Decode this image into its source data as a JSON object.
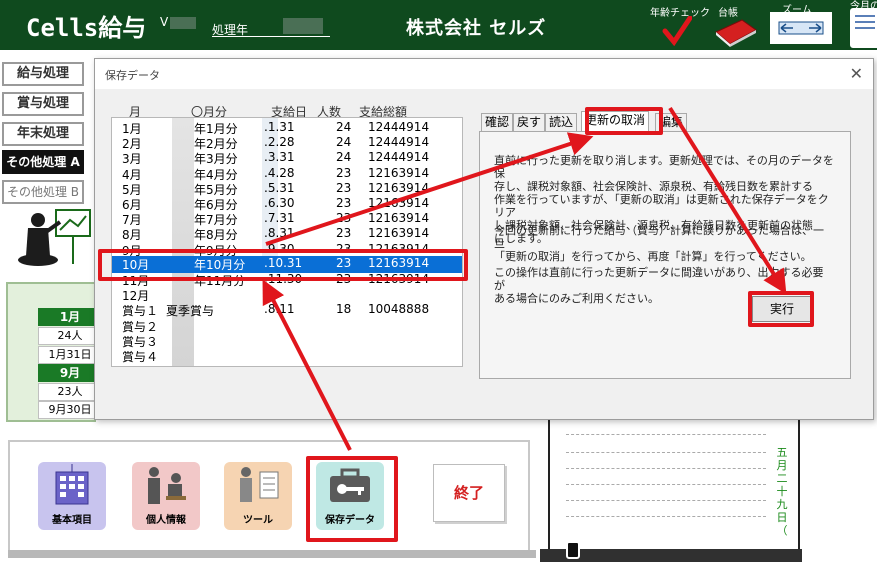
{
  "header": {
    "app_title": "Cells給与",
    "version_prefix": "V",
    "year_label": "処理年",
    "company": "株式会社 セルズ",
    "tools": {
      "age_check": "年齢チェック",
      "ledger": "台帳",
      "zoom": "ズーム",
      "monthly": "今月の"
    }
  },
  "menu": {
    "salary": "給与処理",
    "bonus": "賞与処理",
    "year_end": "年末処理",
    "other_a": "その他処理 A",
    "other_b": "その他処理 B"
  },
  "calendar_panel": {
    "month1": "1月",
    "people1": "24人",
    "date1": "1月31日",
    "month2": "9月",
    "people2": "23人",
    "date2": "9月30日"
  },
  "bottom_tools": {
    "basic": "基本項目",
    "personal": "個人情報",
    "tool": "ツール",
    "saved": "保存データ",
    "end": "終了"
  },
  "sheet": {
    "date_vertical": "五月二十九日（"
  },
  "dialog": {
    "title": "保存データ",
    "close": "✕",
    "columns": {
      "month": "月",
      "period": "〇月分",
      "pay_date": "支給日",
      "people": "人数",
      "total": "支給総額"
    },
    "rows": [
      {
        "month": "1月",
        "period": "年1月分",
        "date": ".1.31",
        "people": "24",
        "total": "12444914"
      },
      {
        "month": "2月",
        "period": "年2月分",
        "date": ".2.28",
        "people": "24",
        "total": "12444914"
      },
      {
        "month": "3月",
        "period": "年3月分",
        "date": ".3.31",
        "people": "24",
        "total": "12444914"
      },
      {
        "month": "4月",
        "period": "年4月分",
        "date": ".4.28",
        "people": "23",
        "total": "12163914"
      },
      {
        "month": "5月",
        "period": "年5月分",
        "date": ".5.31",
        "people": "23",
        "total": "12163914"
      },
      {
        "month": "6月",
        "period": "年6月分",
        "date": ".6.30",
        "people": "23",
        "total": "12163914"
      },
      {
        "month": "7月",
        "period": "年7月分",
        "date": ".7.31",
        "people": "23",
        "total": "12163914"
      },
      {
        "month": "8月",
        "period": "年8月分",
        "date": ".8.31",
        "people": "23",
        "total": "12163914"
      },
      {
        "month": "9月",
        "period": "年9月分",
        "date": ".9.30",
        "people": "23",
        "total": "12163914"
      },
      {
        "month": "10月",
        "period": "年10月分",
        "date": ".10.31",
        "people": "23",
        "total": "12163914"
      },
      {
        "month": "11月",
        "period": "年11月分",
        "date": ".11.30",
        "people": "23",
        "total": "12163914"
      },
      {
        "month": "12月",
        "period": "",
        "date": "",
        "people": "",
        "total": ""
      },
      {
        "month": "賞与１",
        "period": "夏季賞与",
        "date": ".8.11",
        "people": "18",
        "total": "10048888"
      },
      {
        "month": "賞与２",
        "period": "",
        "date": "",
        "people": "",
        "total": ""
      },
      {
        "month": "賞与３",
        "period": "",
        "date": "",
        "people": "",
        "total": ""
      },
      {
        "month": "賞与４",
        "period": "",
        "date": "",
        "people": "",
        "total": ""
      }
    ],
    "tabs": [
      "確認",
      "戻す",
      "読込",
      "更新の取消",
      "編集"
    ],
    "description": [
      "直前に行った更新を取り消します。更新処理では、その月のデータを保",
      "存し、課税対象額、社会保険計、源泉税、有給残日数を累計する",
      "作業を行っていますが、「更新の取消」は更新された保存データをクリア",
      "し課税対象額、社会保険計、源泉税、有給残日数を更新前の状態",
      "にします。",
      "今回の更新前に行った給与（賞与）計算に誤りがあった場合は、一旦",
      "「更新の取消」を行ってから、再度「計算」を行ってください。",
      "この操作は直前に行った更新データに間違いがあり、出力する必要が",
      "ある場合にのみご利用ください。"
    ],
    "execute": "実行"
  },
  "colors": {
    "header_green": "#0f4a1e",
    "selection_blue": "#0a6fd6",
    "highlight_red": "#e0161c"
  }
}
